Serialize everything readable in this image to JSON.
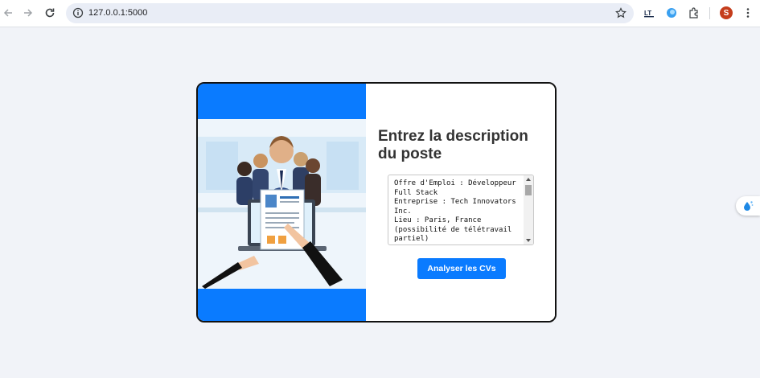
{
  "browser": {
    "url": "127.0.0.1:5000",
    "profile_initial": "S",
    "extension_label": "LT"
  },
  "page": {
    "heading": "Entrez la description du poste",
    "description_text": "Offre d'Emploi : Développeur Full Stack\nEntreprise : Tech Innovators Inc.\nLieu : Paris, France (possibilité de télétravail partiel)",
    "analyze_button_label": "Analyser les CVs"
  },
  "colors": {
    "accent": "#0a7bff",
    "page_bg": "#f1f3f8"
  },
  "icons": [
    "back-icon",
    "forward-icon",
    "reload-icon",
    "info-icon",
    "star-icon",
    "extensions-icon",
    "menu-icon",
    "side-assistant-icon"
  ]
}
